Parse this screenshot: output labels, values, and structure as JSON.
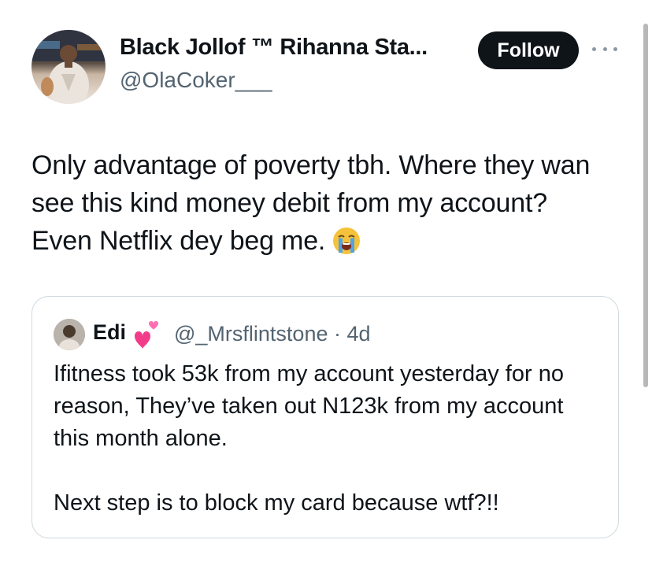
{
  "tweet": {
    "author": {
      "display_name": "Black Jollof ™ Rihanna Sta...",
      "handle": "@OlaCoker___"
    },
    "follow_label": "Follow",
    "text": "Only advantage of poverty tbh. Where they wan see this kind money debit from my account? Even Netflix dey beg me.",
    "emoji_icon": "loudly-crying-face-icon"
  },
  "quoted_tweet": {
    "display_name": "Edi",
    "name_emoji_icon": "revolving-hearts-icon",
    "handle_time": "@_Mrsflintstone · 4d",
    "text": "Ifitness took 53k from my account yesterday for no reason, They’ve taken out N123k from my account this month alone.\n\nNext step is to block my card because wtf?!!"
  },
  "colors": {
    "text": "#0f1419",
    "secondary": "#536471",
    "border": "#cfd9de",
    "button_bg": "#0f1419"
  }
}
